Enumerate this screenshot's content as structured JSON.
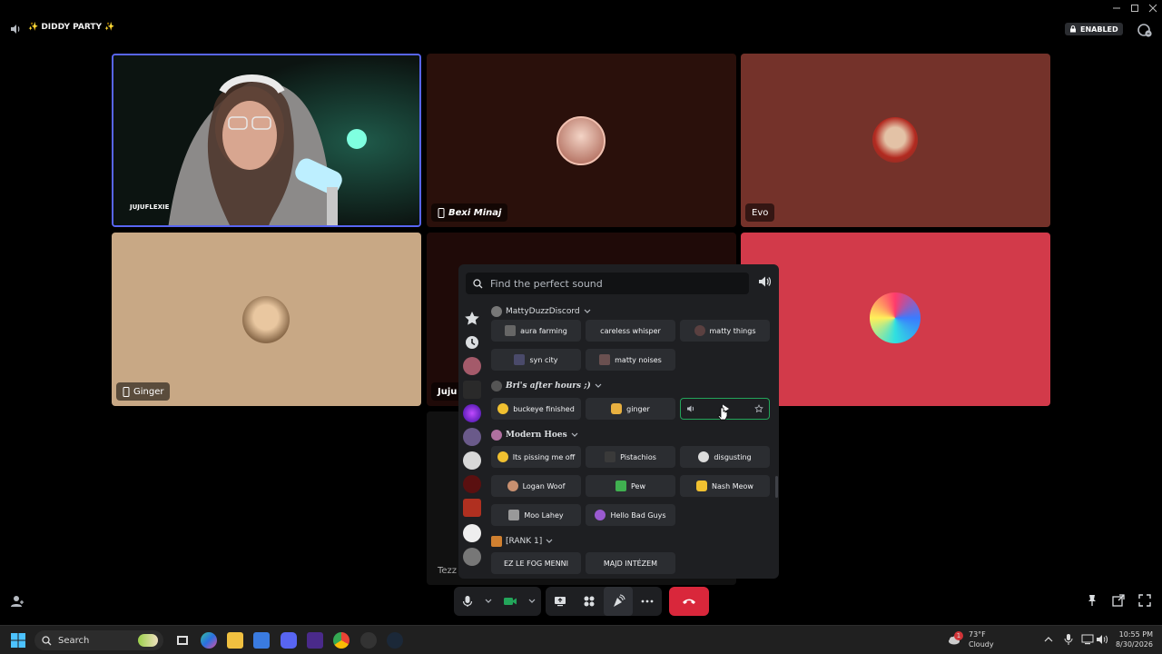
{
  "window": {
    "minimize_icon": "minimize-icon",
    "maximize_icon": "maximize-icon",
    "close_icon": "close-icon"
  },
  "header": {
    "channel_name": "✨ DIDDY PARTY ✨",
    "badge_label": "ENABLED"
  },
  "tiles": {
    "jujuflexie": "JUJUFLEXIE",
    "bexi": "Bexi Minaj",
    "evo": "Evo",
    "ginger": "Ginger",
    "juju": "Juju",
    "tezza": "Tezz"
  },
  "soundboard": {
    "search_placeholder": "Find the perfect sound",
    "categories": {
      "matty": "MattyDuzzDiscord",
      "bri": "Bri's after hours ;)",
      "modern": "Modern Hoes",
      "rank": "[RANK 1]"
    },
    "sounds": {
      "aura_farming": "aura farming",
      "careless_whisper": "careless whisper",
      "matty_things": "matty things",
      "syn_city": "syn city",
      "matty_noises": "matty noises",
      "buckeye_finished": "buckeye finished",
      "ginger": "ginger",
      "its_pissing": "Its pissing me off",
      "pistachios": "Pistachios",
      "disgusting": "disgusting",
      "logan_woof": "Logan Woof",
      "pew": "Pew",
      "nash_meow": "Nash Meow",
      "moo_lahey": "Moo Lahey",
      "hello_bad_guys": "Hello Bad Guys",
      "ez_le_fog": "EZ LE FOG MENNI",
      "majd_intezem": "MAJD INTÉZEM"
    }
  },
  "taskbar": {
    "search_label": "Search",
    "weather_temp": "73°F",
    "weather_desc": "Cloudy",
    "weather_badge": "1",
    "time": "10:55 PM",
    "date": "8/30/2026"
  },
  "colors": {
    "accent": "#5865f2",
    "hangup": "#d9273b",
    "panel": "#1e1f22",
    "button": "#2b2d31",
    "camera_on": "#23a55a"
  }
}
